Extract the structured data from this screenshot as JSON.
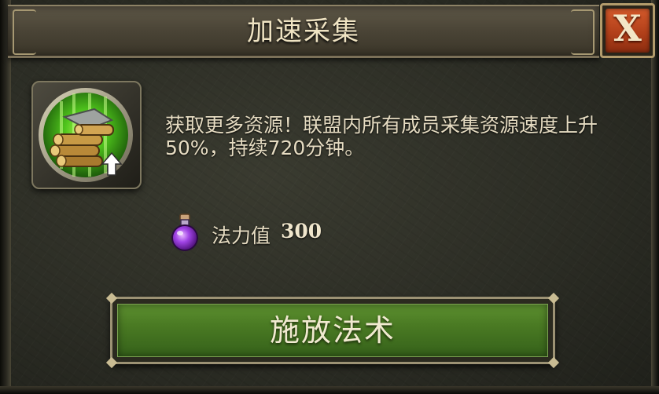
{
  "dialog": {
    "title": "加速采集",
    "close_label": "X"
  },
  "spell": {
    "icon": "resource-gathering-boost-icon",
    "description": "获取更多资源！联盟内所有成员采集资源速度上升50%，持续720分钟。"
  },
  "cost": {
    "icon": "mana-potion-icon",
    "label": "法力值",
    "value": "300"
  },
  "actions": {
    "cast_label": "施放法术"
  },
  "colors": {
    "close_button": "#c44c22",
    "cast_button": "#4a7a23",
    "potion": "#9b3fd8"
  }
}
